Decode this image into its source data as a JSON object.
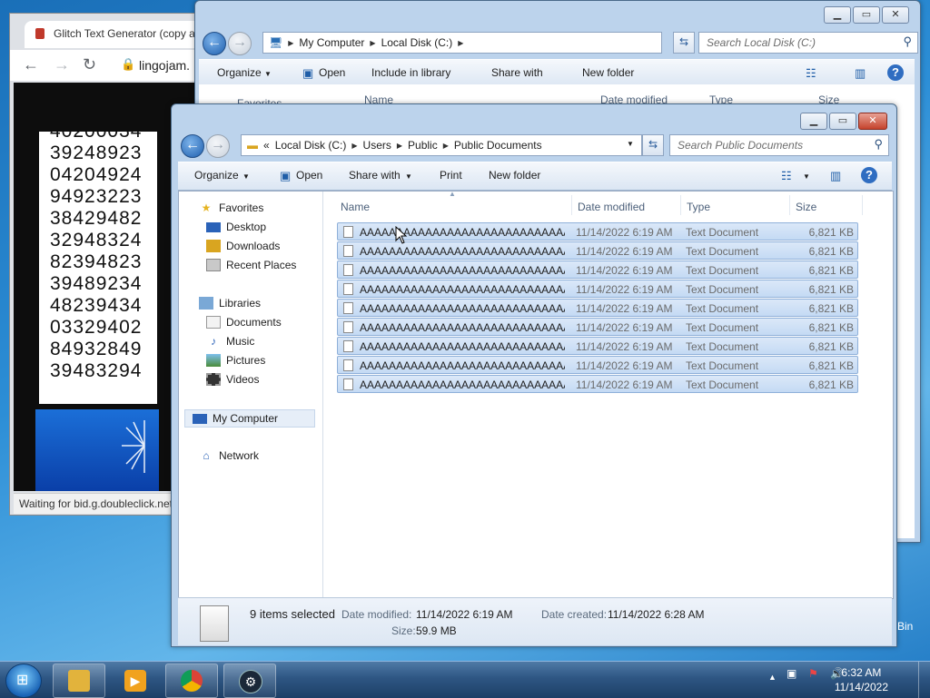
{
  "browser": {
    "tab_title": "Glitch Text Generator (copy and",
    "url": "lingojam.",
    "numbers": [
      "40200034",
      "39248923",
      "04204924",
      "94923223",
      "38429482",
      "32948324",
      "82394823",
      "39489234",
      "48239434",
      "03329402",
      "84932849",
      "39483294"
    ],
    "status": "Waiting for bid.g.doubleclick.net..."
  },
  "explorer_back": {
    "breadcrumb": [
      "My Computer",
      "Local Disk (C:)"
    ],
    "search_placeholder": "Search Local Disk (C:)",
    "commands": [
      "Organize",
      "Open",
      "Include in library",
      "Share with",
      "New folder"
    ],
    "columns": [
      "Favorites",
      "Name",
      "Date modified",
      "Type",
      "Size"
    ]
  },
  "explorer_front": {
    "breadcrumb_prefix": "«",
    "breadcrumb": [
      "Local Disk (C:)",
      "Users",
      "Public",
      "Public Documents"
    ],
    "search_placeholder": "Search Public Documents",
    "commands": {
      "organize": "Organize",
      "open": "Open",
      "share": "Share with",
      "print": "Print",
      "new_folder": "New folder"
    },
    "nav": {
      "favorites": "Favorites",
      "desktop": "Desktop",
      "downloads": "Downloads",
      "recent": "Recent Places",
      "libraries": "Libraries",
      "documents": "Documents",
      "music": "Music",
      "pictures": "Pictures",
      "videos": "Videos",
      "computer": "My Computer",
      "network": "Network"
    },
    "columns": {
      "name": "Name",
      "date": "Date modified",
      "type": "Type",
      "size": "Size"
    },
    "files": [
      {
        "name": "AAAAAAAAAAAAAAAAAAAAAAAAAAAAAAAAAAAAAAAA...",
        "date": "11/14/2022 6:19 AM",
        "type": "Text Document",
        "size": "6,821 KB"
      },
      {
        "name": "AAAAAAAAAAAAAAAAAAAAAAAAAAAAAAAAAAAAAAAA...",
        "date": "11/14/2022 6:19 AM",
        "type": "Text Document",
        "size": "6,821 KB"
      },
      {
        "name": "AAAAAAAAAAAAAAAAAAAAAAAAAAAAAAAAAAAAAAAA...",
        "date": "11/14/2022 6:19 AM",
        "type": "Text Document",
        "size": "6,821 KB"
      },
      {
        "name": "AAAAAAAAAAAAAAAAAAAAAAAAAAAAAAAAAAAAAAAA...",
        "date": "11/14/2022 6:19 AM",
        "type": "Text Document",
        "size": "6,821 KB"
      },
      {
        "name": "AAAAAAAAAAAAAAAAAAAAAAAAAAAAAAAAAAAAAAAA...",
        "date": "11/14/2022 6:19 AM",
        "type": "Text Document",
        "size": "6,821 KB"
      },
      {
        "name": "AAAAAAAAAAAAAAAAAAAAAAAAAAAAAAAAAAAAAAAA...",
        "date": "11/14/2022 6:19 AM",
        "type": "Text Document",
        "size": "6,821 KB"
      },
      {
        "name": "AAAAAAAAAAAAAAAAAAAAAAAAAAAAAAAAAAAAAAAA...",
        "date": "11/14/2022 6:19 AM",
        "type": "Text Document",
        "size": "6,821 KB"
      },
      {
        "name": "AAAAAAAAAAAAAAAAAAAAAAAAAAAAAAAAAAAAAAAA...",
        "date": "11/14/2022 6:19 AM",
        "type": "Text Document",
        "size": "6,821 KB"
      },
      {
        "name": "AAAAAAAAAAAAAAAAAAAAAAAAAAAAAAAAAAAAAAAA...",
        "date": "11/14/2022 6:19 AM",
        "type": "Text Document",
        "size": "6,821 KB"
      }
    ],
    "details": {
      "selected": "9 items selected",
      "date_modified_label": "Date modified:",
      "date_modified": "11/14/2022 6:19 AM",
      "date_created_label": "Date created:",
      "date_created": "11/14/2022 6:28 AM",
      "size_label": "Size:",
      "size": "59.9 MB"
    }
  },
  "desktop": {
    "recycle_bin_fragment": "Bin"
  },
  "taskbar": {
    "time": "6:32 AM",
    "date": "11/14/2022"
  },
  "colors": {
    "selection": "#c4daf4",
    "taskbar": "#2e5683",
    "accent": "#1e5fae"
  }
}
